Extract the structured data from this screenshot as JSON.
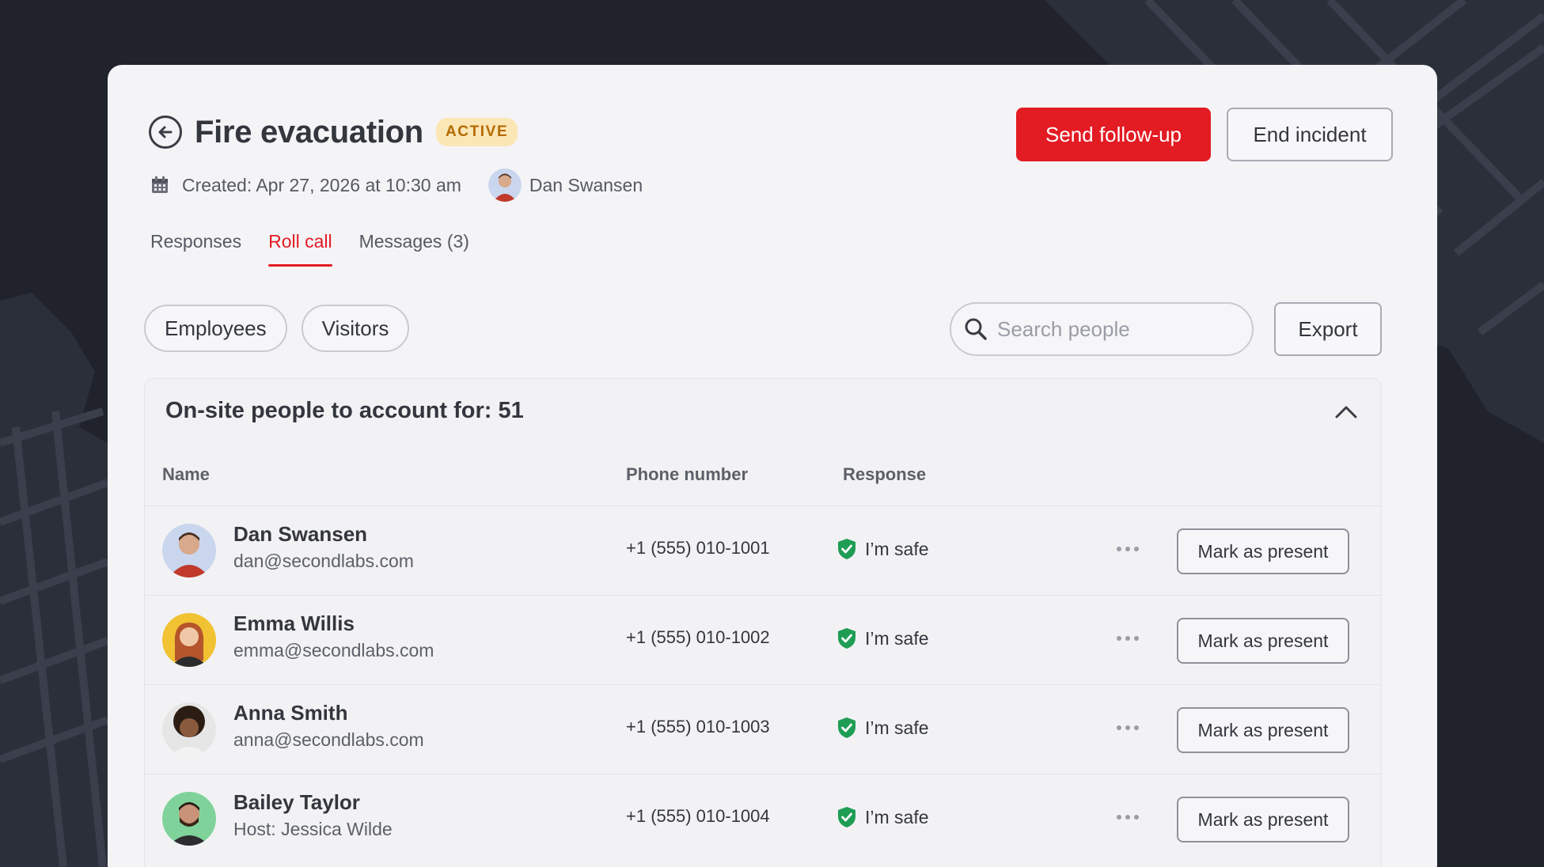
{
  "incident": {
    "title": "Fire evacuation",
    "status": "ACTIVE",
    "created": "Created: Apr 27, 2026 at 10:30 am",
    "creator": "Dan Swansen"
  },
  "actions": {
    "send_followup": "Send follow-up",
    "end_incident": "End incident"
  },
  "tabs": [
    {
      "label": "Responses",
      "active": false
    },
    {
      "label": "Roll call",
      "active": true
    },
    {
      "label": "Messages (3)",
      "active": false
    }
  ],
  "filters": [
    "Employees",
    "Visitors"
  ],
  "search": {
    "placeholder": "Search people"
  },
  "export_label": "Export",
  "panel": {
    "title": "On-site people to account for: 51",
    "columns": {
      "name": "Name",
      "phone": "Phone number",
      "response": "Response"
    }
  },
  "people": [
    {
      "name": "Dan Swansen",
      "sub": "dan@secondlabs.com",
      "phone": "+1 (555) 010-1001",
      "response": "I’m safe",
      "action": "Mark as present",
      "avatar_bg": "#c9d6ee"
    },
    {
      "name": "Emma Willis",
      "sub": "emma@secondlabs.com",
      "phone": "+1 (555) 010-1002",
      "response": "I’m safe",
      "action": "Mark as present",
      "avatar_bg": "#f1c232"
    },
    {
      "name": "Anna Smith",
      "sub": "anna@secondlabs.com",
      "phone": "+1 (555) 010-1003",
      "response": "I’m safe",
      "action": "Mark as present",
      "avatar_bg": "#e6e6e6"
    },
    {
      "name": "Bailey Taylor",
      "sub": "Host: Jessica Wilde",
      "phone": "+1 (555) 010-1004",
      "response": "I’m safe",
      "action": "Mark as present",
      "avatar_bg": "#7fd39a"
    }
  ],
  "colors": {
    "accent": "#e31b23",
    "safe": "#1f9d55",
    "badge_bg": "#fbe6b6"
  }
}
